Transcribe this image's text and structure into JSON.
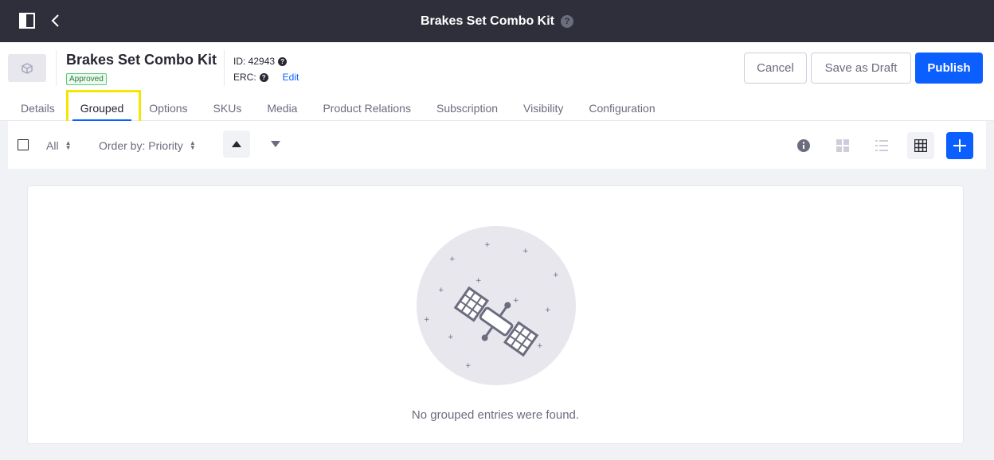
{
  "topbar": {
    "title": "Brakes Set Combo Kit",
    "help_glyph": "?"
  },
  "product": {
    "name": "Brakes Set Combo Kit",
    "status": "Approved",
    "id_label": "ID: 42943",
    "erc_label": "ERC:",
    "edit_label": "Edit"
  },
  "actions": {
    "cancel": "Cancel",
    "save_draft": "Save as Draft",
    "publish": "Publish"
  },
  "tabs": [
    {
      "label": "Details",
      "active": false
    },
    {
      "label": "Grouped",
      "active": true
    },
    {
      "label": "Options",
      "active": false
    },
    {
      "label": "SKUs",
      "active": false
    },
    {
      "label": "Media",
      "active": false
    },
    {
      "label": "Product Relations",
      "active": false
    },
    {
      "label": "Subscription",
      "active": false
    },
    {
      "label": "Visibility",
      "active": false
    },
    {
      "label": "Configuration",
      "active": false
    }
  ],
  "toolbar": {
    "filter": "All",
    "order_by": "Order by: Priority"
  },
  "empty_state": {
    "message": "No grouped entries were found."
  },
  "colors": {
    "primary": "#0b5fff",
    "topbar": "#2e2f3a",
    "highlight": "#f5e600",
    "approved": "#287d3c"
  }
}
